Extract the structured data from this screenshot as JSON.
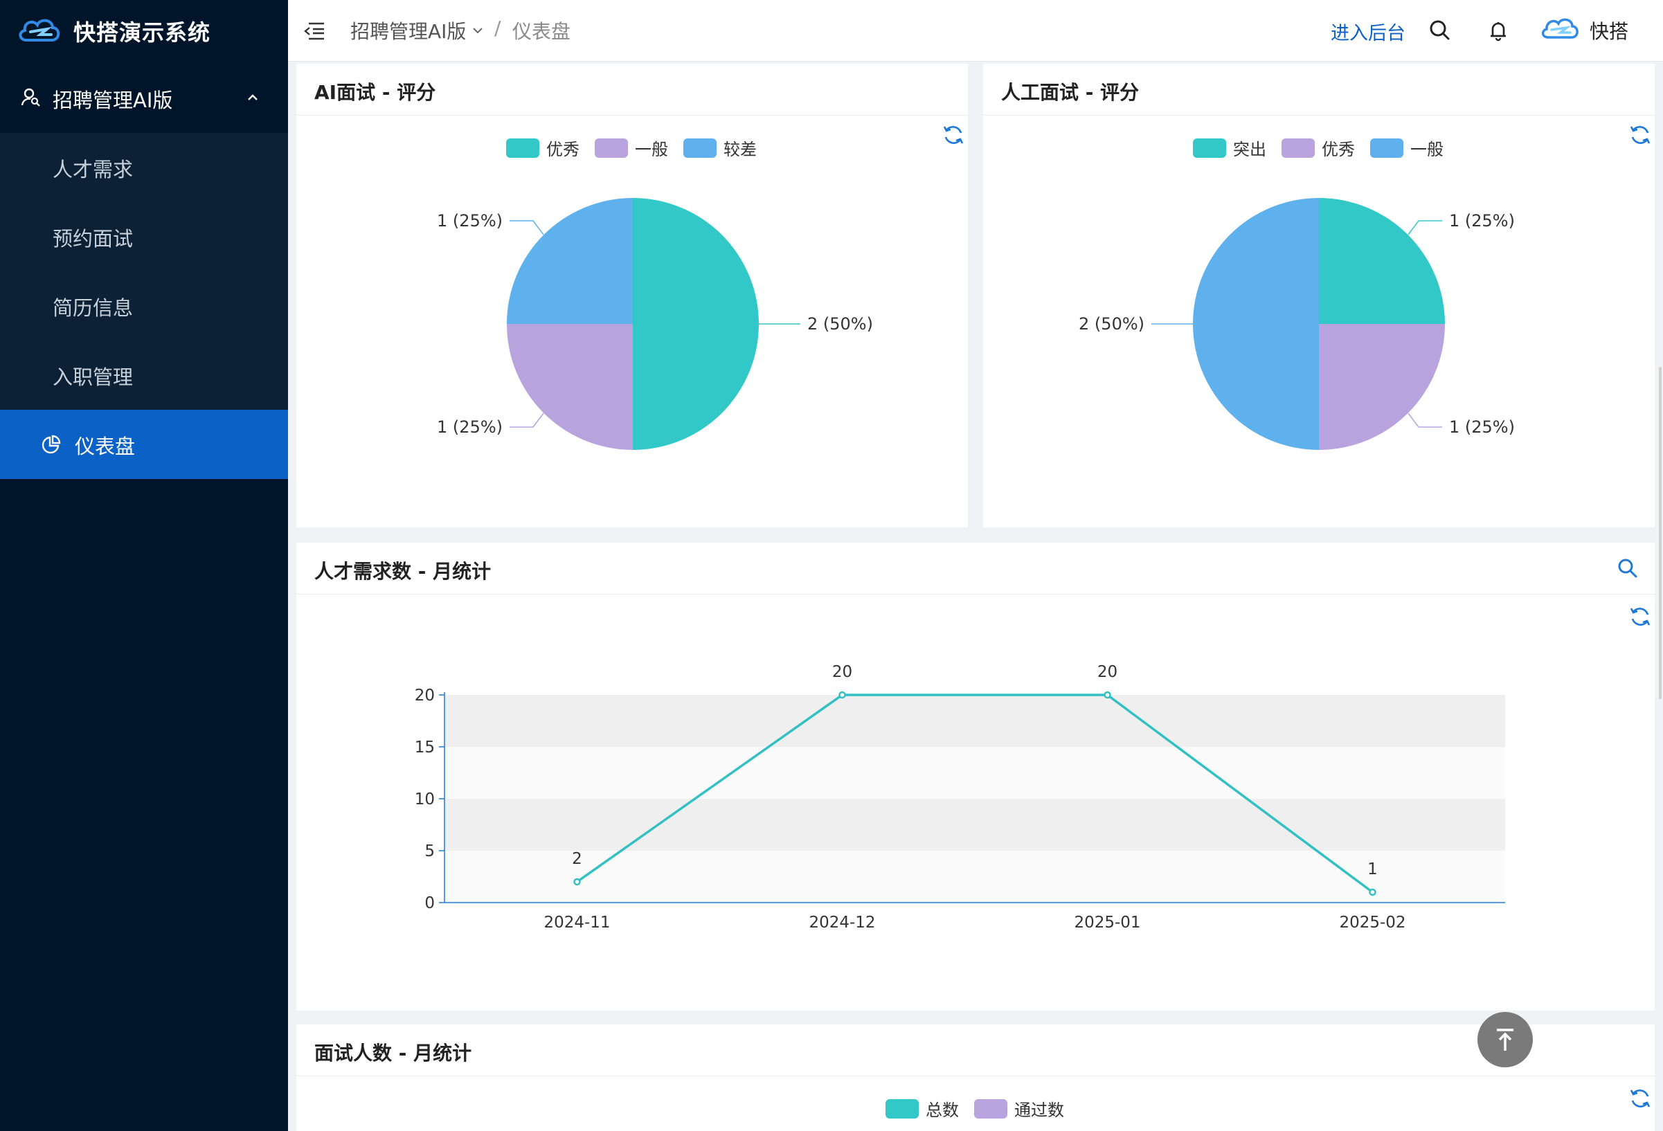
{
  "app": {
    "title": "快搭演示系统"
  },
  "sidebar": {
    "group_label": "招聘管理AI版",
    "items": [
      {
        "label": "人才需求"
      },
      {
        "label": "预约面试"
      },
      {
        "label": "简历信息"
      },
      {
        "label": "入职管理"
      },
      {
        "label": "仪表盘",
        "active": true
      }
    ]
  },
  "topbar": {
    "breadcrumb": [
      "招聘管理AI版",
      "仪表盘"
    ],
    "separator": "/",
    "backend_link": "进入后台",
    "username": "快搭"
  },
  "colors": {
    "sidebar_bg": "#001529",
    "active": "#0b61c6",
    "teal": "#33c8c8",
    "purple": "#b8a3df",
    "blue": "#5eb1ec"
  },
  "cards": {
    "ai_interview": {
      "title": "AI面试 - 评分"
    },
    "human_interview": {
      "title": "人工面试 - 评分"
    },
    "talent_demand": {
      "title": "人才需求数 - 月统计"
    },
    "interview_count": {
      "title": "面试人数 - 月统计"
    }
  },
  "chart_data": [
    {
      "type": "pie",
      "title": "AI面试 - 评分",
      "legend": [
        "优秀",
        "一般",
        "较差"
      ],
      "slices": [
        {
          "name": "优秀",
          "value": 2,
          "label": "2 (50%)"
        },
        {
          "name": "一般",
          "value": 1,
          "label": "1 (25%)"
        },
        {
          "name": "较差",
          "value": 1,
          "label": "1 (25%)"
        }
      ]
    },
    {
      "type": "pie",
      "title": "人工面试 - 评分",
      "legend": [
        "突出",
        "优秀",
        "一般"
      ],
      "slices": [
        {
          "name": "突出",
          "value": 1,
          "label": "1 (25%)"
        },
        {
          "name": "优秀",
          "value": 1,
          "label": "1 (25%)"
        },
        {
          "name": "一般",
          "value": 2,
          "label": "2 (50%)"
        }
      ]
    },
    {
      "type": "line",
      "title": "人才需求数 - 月统计",
      "categories": [
        "2024-11",
        "2024-12",
        "2025-01",
        "2025-02"
      ],
      "values": [
        2,
        20,
        20,
        1
      ],
      "yticks": [
        "0",
        "5",
        "10",
        "15",
        "20"
      ],
      "ylim": [
        0,
        20
      ]
    },
    {
      "type": "bar",
      "title": "面试人数 - 月统计",
      "legend": [
        "总数",
        "通过数"
      ]
    }
  ]
}
